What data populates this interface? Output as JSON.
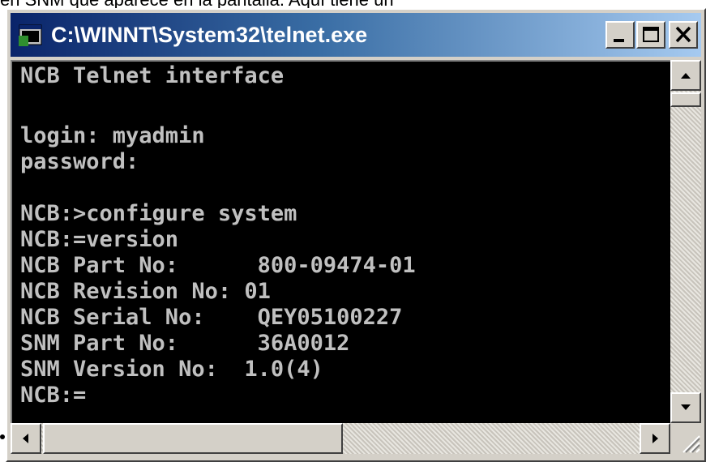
{
  "document": {
    "top_text": "en SNM que aparece en la pantalla. Aquí tiene un"
  },
  "window": {
    "title": "C:\\WINNT\\System32\\telnet.exe",
    "icon": "console-window-icon",
    "controls": {
      "minimize_icon": "minimize-icon",
      "maximize_icon": "maximize-icon",
      "close_icon": "close-icon"
    }
  },
  "console": {
    "background": "#000000",
    "foreground": "#c0c0c0",
    "lines": [
      "NCB Telnet interface",
      "",
      "login: myadmin",
      "password:",
      "",
      "NCB:>configure system",
      "NCB:=version",
      "NCB Part No:      800-09474-01",
      "NCB Revision No: 01",
      "NCB Serial No:    QEY05100227",
      "SNM Part No:      36A0012",
      "SNM Version No:  1.0(4)",
      "NCB:="
    ]
  },
  "colors": {
    "title_gradient_start": "#0a246a",
    "title_gradient_end": "#a6caf0",
    "chrome": "#d4d0c8"
  }
}
